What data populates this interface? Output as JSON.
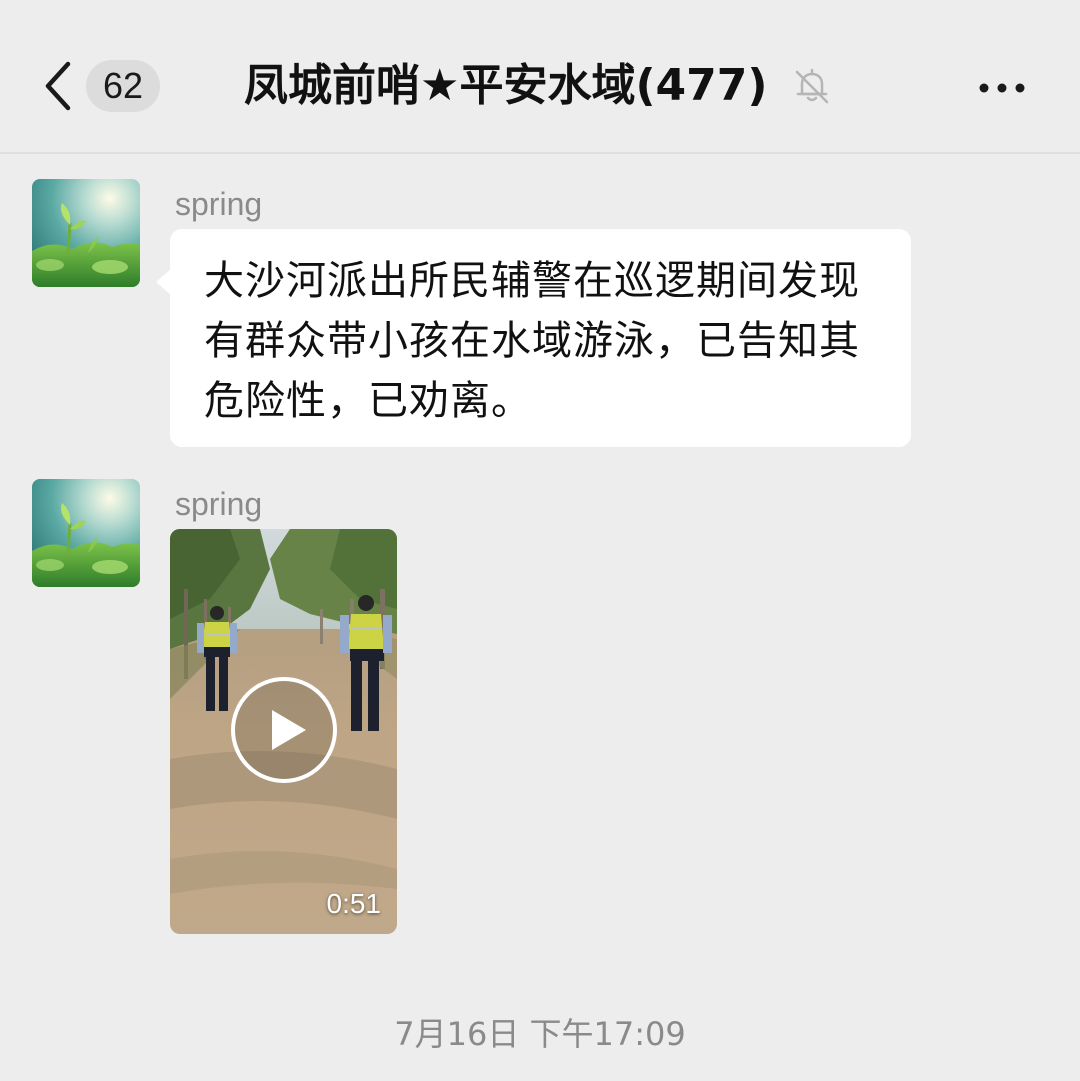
{
  "header": {
    "back_icon": "chevron-left-icon",
    "unread_count": "62",
    "title": "凤城前哨★平安水域(477)",
    "mute_icon": "bell-off-icon",
    "more_icon": "more-dots-icon"
  },
  "messages": [
    {
      "sender": "spring",
      "type": "text",
      "text": "大沙河派出所民辅警在巡逻期间发现有群众带小孩在水域游泳，已告知其危险性，已劝离。"
    },
    {
      "sender": "spring",
      "type": "video",
      "duration": "0:51",
      "play_icon": "play-icon"
    }
  ],
  "timestamp": "7月16日 下午17:09",
  "colors": {
    "background": "#ededed",
    "bubble": "#ffffff",
    "secondary_text": "#8a8a8a",
    "badge_bg": "#dcdcdc"
  }
}
